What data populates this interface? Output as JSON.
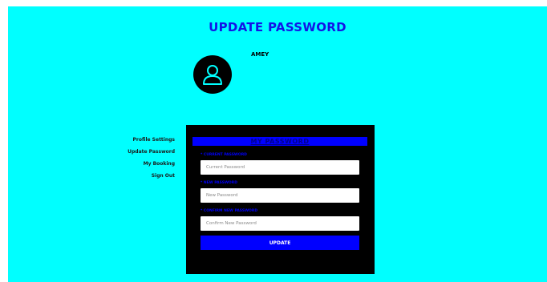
{
  "page": {
    "title": "UPDATE PASSWORD",
    "background_color": "#00ffff",
    "accent_color": "#0000ff"
  },
  "profile": {
    "username": "AMEY",
    "avatar_icon": "user-icon"
  },
  "sidebar": {
    "items": [
      {
        "label": "Profile Settings"
      },
      {
        "label": "Update Password"
      },
      {
        "label": "My Booking"
      },
      {
        "label": "Sign Out"
      }
    ]
  },
  "form": {
    "heading": "MY PASSWORD",
    "current": {
      "label": "* CURRENT PASSWORD",
      "placeholder": "Current Password",
      "value": ""
    },
    "new": {
      "label": "* NEW PASSWORD",
      "placeholder": "New Password",
      "value": ""
    },
    "confirm": {
      "label": "* CONFIRM NEW PASSWORD",
      "placeholder": "Confirm New Password",
      "value": ""
    },
    "submit_label": "UPDATE"
  }
}
